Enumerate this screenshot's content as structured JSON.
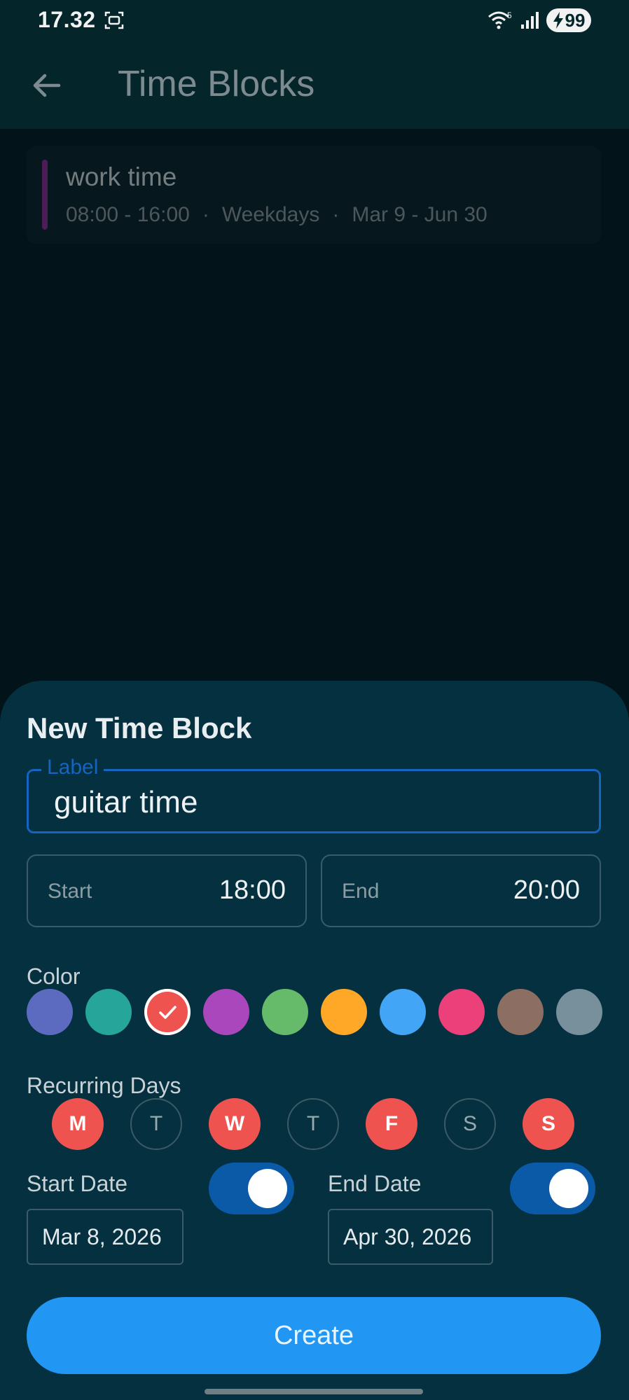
{
  "status_bar": {
    "time": "17.32",
    "wifi_badge": "5",
    "battery": "99"
  },
  "app_bar": {
    "title": "Time Blocks"
  },
  "blocks": [
    {
      "name": "work time",
      "time_range": "08:00 - 16:00",
      "recurrence": "Weekdays",
      "date_range": "Mar 9 - Jun 30",
      "color": "#4e1d57"
    }
  ],
  "sheet": {
    "title": "New Time Block",
    "label_field": {
      "legend": "Label",
      "value": "guitar time"
    },
    "start_field": {
      "label": "Start",
      "value": "18:00"
    },
    "end_field": {
      "label": "End",
      "value": "20:00"
    },
    "color_label": "Color",
    "colors": [
      "#5c6bc0",
      "#26a69a",
      "#ef5350",
      "#ab47bc",
      "#66bb6a",
      "#ffa726",
      "#42a5f5",
      "#ec407a",
      "#8d6e63",
      "#78909c"
    ],
    "selected_color_index": 2,
    "recurring_label": "Recurring Days",
    "days": [
      {
        "letter": "M",
        "on": true
      },
      {
        "letter": "T",
        "on": false
      },
      {
        "letter": "W",
        "on": true
      },
      {
        "letter": "T",
        "on": false
      },
      {
        "letter": "F",
        "on": true
      },
      {
        "letter": "S",
        "on": false
      },
      {
        "letter": "S",
        "on": true
      }
    ],
    "start_date": {
      "label": "Start Date",
      "value": "Mar 8, 2026",
      "enabled": true
    },
    "end_date": {
      "label": "End Date",
      "value": "Apr 30, 2026",
      "enabled": true
    },
    "create_label": "Create"
  }
}
